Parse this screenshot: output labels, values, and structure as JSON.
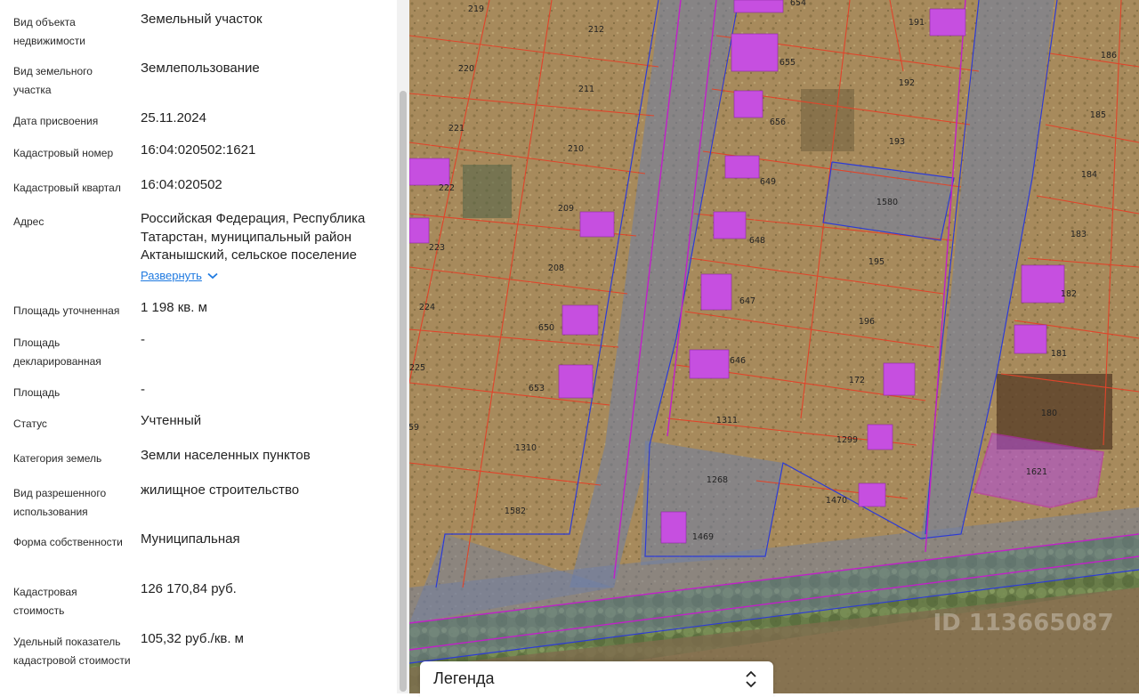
{
  "properties": [
    {
      "label": "Вид объекта недвижимости",
      "value": "Земельный участок"
    },
    {
      "label": "Вид земельного участка",
      "value": "Землепользование"
    },
    {
      "label": "Дата присвоения",
      "value": "25.11.2024"
    },
    {
      "label": "Кадастровый номер",
      "value": "16:04:020502:1621"
    },
    {
      "label": "Кадастровый квартал",
      "value": "16:04:020502"
    },
    {
      "label": "Адрес",
      "value": "Российская Федерация, Республика Татарстан, муниципальный район Актанышский, сельское поселение"
    },
    {
      "label": "Площадь уточненная",
      "value": "1 198 кв. м"
    },
    {
      "label": "Площадь декларированная",
      "value": "-"
    },
    {
      "label": "Площадь",
      "value": "-"
    },
    {
      "label": "Статус",
      "value": "Учтенный"
    },
    {
      "label": "Категория земель",
      "value": "Земли населенных пунктов"
    },
    {
      "label": "Вид разрешенного использования",
      "value": "жилищное строительство"
    },
    {
      "label": "Форма собственности",
      "value": "Муниципальная"
    },
    {
      "label": "Кадастровая стоимость",
      "value": "126 170,84 руб."
    },
    {
      "label": "Удельный показатель кадастровой стоимости",
      "value": "105,32 руб./кв. м"
    }
  ],
  "address_expand_label": "Развернуть",
  "legend": {
    "title": "Легенда"
  },
  "map": {
    "parcel_labels": [
      "219",
      "212",
      "654",
      "191",
      "186",
      "220",
      "655",
      "192",
      "211",
      "185",
      "221",
      "656",
      "193",
      "210",
      "649",
      "184",
      "222",
      "1580",
      "209",
      "648",
      "183",
      "223",
      "195",
      "208",
      "182",
      "224",
      "647",
      "650",
      "196",
      "181",
      "225",
      "646",
      "653",
      "172",
      "180",
      "59",
      "1311",
      "1299",
      "1310",
      "1621",
      "1268",
      "1470",
      "1582",
      "1469"
    ],
    "colors": {
      "parcel_border": "#e0442a",
      "quarter_border": "#2d3bd6",
      "zone_border": "#c21fc9",
      "building_fill": "#c64fe0",
      "selected_fill": "#b54ae0",
      "road_fill": "#6d7fa8"
    },
    "watermark": "ID 113665087"
  }
}
